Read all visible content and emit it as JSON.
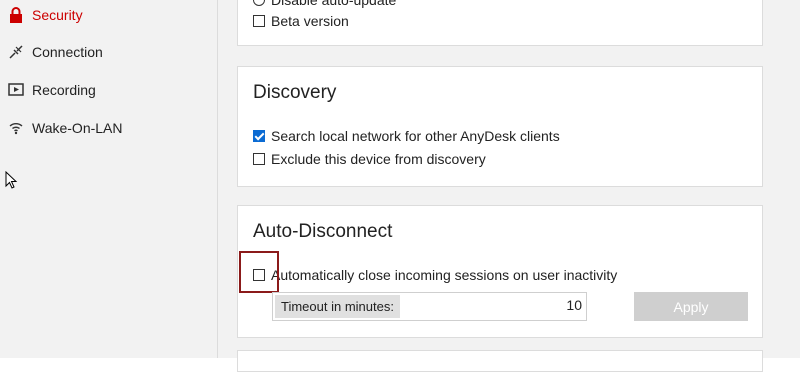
{
  "sidebar": {
    "items": [
      {
        "label": "Security",
        "icon": "lock-icon",
        "active": true
      },
      {
        "label": "Connection",
        "icon": "connection-icon",
        "active": false
      },
      {
        "label": "Recording",
        "icon": "recording-icon",
        "active": false
      },
      {
        "label": "Wake-On-LAN",
        "icon": "wifi-icon",
        "active": false
      }
    ]
  },
  "updates_card": {
    "items": [
      {
        "label": "Disable auto-update",
        "type": "radio",
        "checked": false
      },
      {
        "label": "Beta version",
        "type": "checkbox",
        "checked": false
      }
    ]
  },
  "discovery_card": {
    "title": "Discovery",
    "items": [
      {
        "label": "Search local network for other AnyDesk clients",
        "checked": true
      },
      {
        "label": "Exclude this device from discovery",
        "checked": false
      }
    ]
  },
  "autodisconnect_card": {
    "title": "Auto-Disconnect",
    "checkbox_label": "Automatically close incoming sessions on user inactivity",
    "checked": false,
    "timeout_label": "Timeout in minutes:",
    "timeout_value": "10",
    "apply_label": "Apply"
  },
  "colors": {
    "accent_active": "#cc0000",
    "checkbox_checked": "#0b6bd3",
    "highlight": "#8b1a1a",
    "button_disabled": "#cfcfcf"
  }
}
